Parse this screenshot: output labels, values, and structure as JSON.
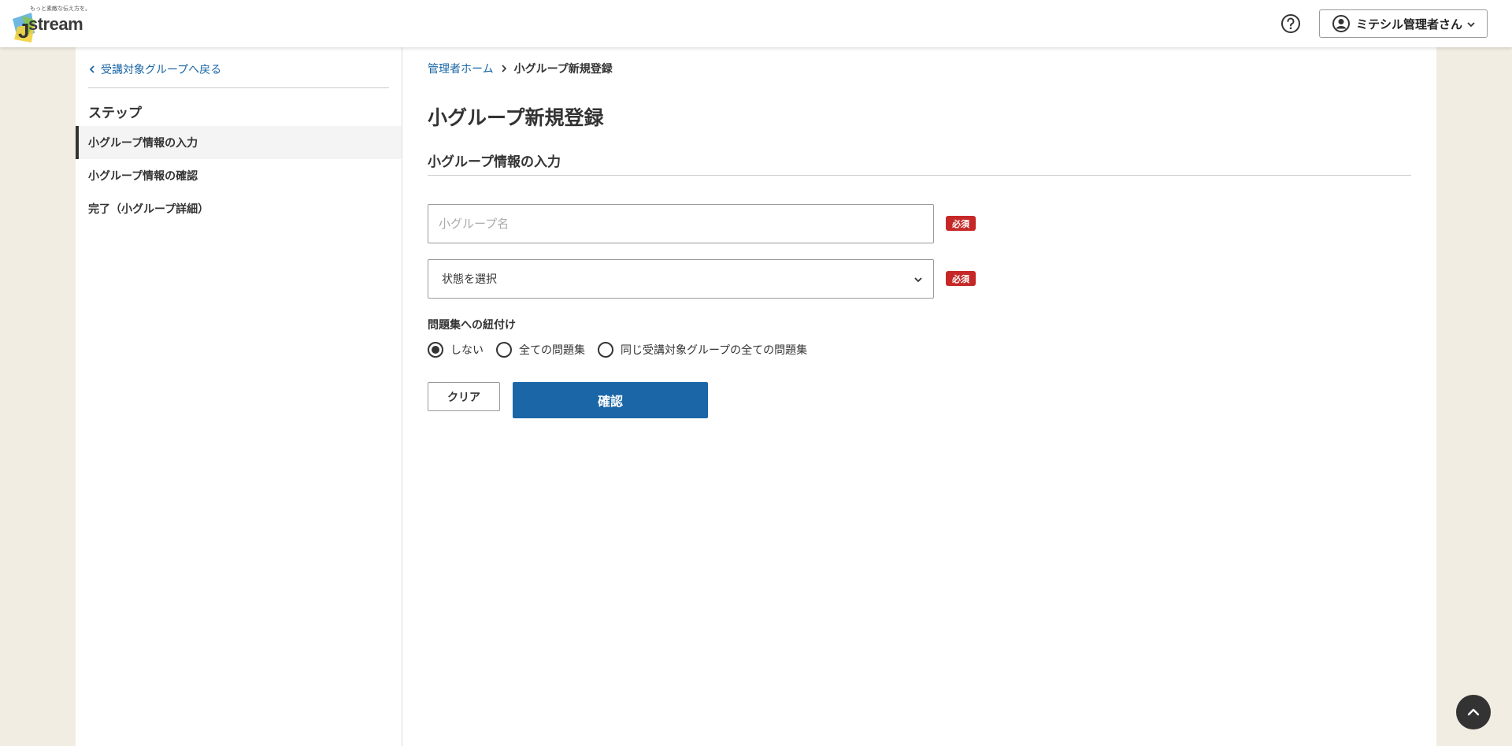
{
  "header": {
    "logo_tagline": "もっと素敵な伝え方を。",
    "logo_text": "stream",
    "help_icon": "question-circle-icon",
    "user_name": "ミテシル管理者さん"
  },
  "sidebar": {
    "back_link": "受講対象グループへ戻る",
    "steps_title": "ステップ",
    "steps": [
      {
        "label": "小グループ情報の入力",
        "active": true
      },
      {
        "label": "小グループ情報の確認",
        "active": false
      },
      {
        "label": "完了（小グループ詳細）",
        "active": false
      }
    ]
  },
  "main": {
    "breadcrumb": {
      "home": "管理者ホーム",
      "current": "小グループ新規登録"
    },
    "page_title": "小グループ新規登録",
    "section_title": "小グループ情報の入力",
    "name_field": {
      "placeholder": "小グループ名",
      "value": ""
    },
    "status_select": {
      "selected": "状態を選択"
    },
    "required_badge": "必須",
    "link_label": "問題集への紐付け",
    "radio_options": [
      {
        "label": "しない",
        "checked": true
      },
      {
        "label": "全ての問題集",
        "checked": false
      },
      {
        "label": "同じ受講対象グループの全ての問題集",
        "checked": false
      }
    ],
    "clear_button": "クリア",
    "confirm_button": "確認"
  },
  "colors": {
    "accent": "#1a66a6",
    "required": "#c62828",
    "page_bg": "#f2ede3"
  }
}
